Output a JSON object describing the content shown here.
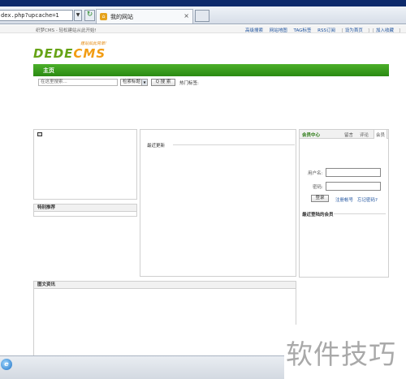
{
  "browser": {
    "address": "dex.php?upcache=1",
    "tab_title": "我的网站",
    "tab_close": "×",
    "dropdown_glyph": "▼",
    "refresh_glyph": "↻",
    "tab_icon": "house-icon"
  },
  "topbar": {
    "welcome": "织梦CMS - 轻松建站从此开始!",
    "links": [
      "高级搜索",
      "网站地图",
      "TAG标签",
      "RSS订阅"
    ],
    "extra_links": [
      "设为首页",
      "加入收藏"
    ]
  },
  "logo": {
    "main_a": "DEDE",
    "main_b": "CMS",
    "slogan": "建站如此简单!"
  },
  "nav": {
    "home": "主页"
  },
  "search": {
    "placeholder": "在这里搜索...",
    "type_value": "检索标题",
    "button": "Q 搜 索",
    "hot": "热门标签:"
  },
  "panels": {
    "featured": "特别推荐",
    "latest": "最近更新",
    "picture_news": "图文资讯"
  },
  "member": {
    "title": "会员中心",
    "tabs": [
      "留言",
      "评论",
      "会员"
    ],
    "username_label": "用户名:",
    "password_label": "密码:",
    "login_button": "登录",
    "register": "注册帐号",
    "forgot": "忘记密码?",
    "recent_members": "最近登陆的会员"
  },
  "watermark": "软件技巧",
  "colors": {
    "nav_green": "#2a8a13",
    "logo_green": "#66a316",
    "logo_orange": "#f29c12",
    "link_blue": "#1a4f9c"
  }
}
